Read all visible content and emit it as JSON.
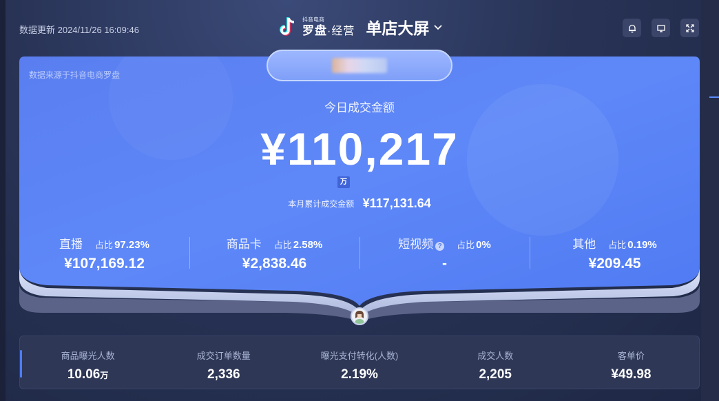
{
  "header": {
    "update_text": "数据更新 2024/11/26 16:09:46",
    "brand_small": "抖音电商",
    "brand_main": "罗盘",
    "brand_sub": "·经营",
    "screen_title": "单店大屏"
  },
  "card": {
    "source_note": "数据来源于抖音电商罗盘",
    "today_label": "今日成交金额",
    "today_value": "¥110,217",
    "unit_badge": "万",
    "month_label": "本月累计成交金额",
    "month_value": "¥117,131.64"
  },
  "channels": [
    {
      "name": "直播",
      "ratio_label": "占比",
      "ratio": "97.23%",
      "amount": "¥107,169.12"
    },
    {
      "name": "商品卡",
      "ratio_label": "占比",
      "ratio": "2.58%",
      "amount": "¥2,838.46"
    },
    {
      "name": "短视频",
      "help": "?",
      "ratio_label": "占比",
      "ratio": "0%",
      "amount": "-"
    },
    {
      "name": "其他",
      "ratio_label": "占比",
      "ratio": "0.19%",
      "amount": "¥209.45"
    }
  ],
  "metrics": [
    {
      "label": "商品曝光人数",
      "value": "10.06",
      "unit": "万"
    },
    {
      "label": "成交订单数量",
      "value": "2,336"
    },
    {
      "label": "曝光支付转化(人数)",
      "value": "2.19%"
    },
    {
      "label": "成交人数",
      "value": "2,205"
    },
    {
      "label": "客单价",
      "value": "¥49.98"
    }
  ],
  "colors": {
    "card_blue": "#5b85f6",
    "accent": "#4f7cff",
    "background": "#283356"
  },
  "icons": {
    "brand": "douyin-logo-icon",
    "chevron": "chevron-down-icon",
    "bell": "bell-icon",
    "monitor": "monitor-icon",
    "fullscreen": "fullscreen-icon"
  }
}
